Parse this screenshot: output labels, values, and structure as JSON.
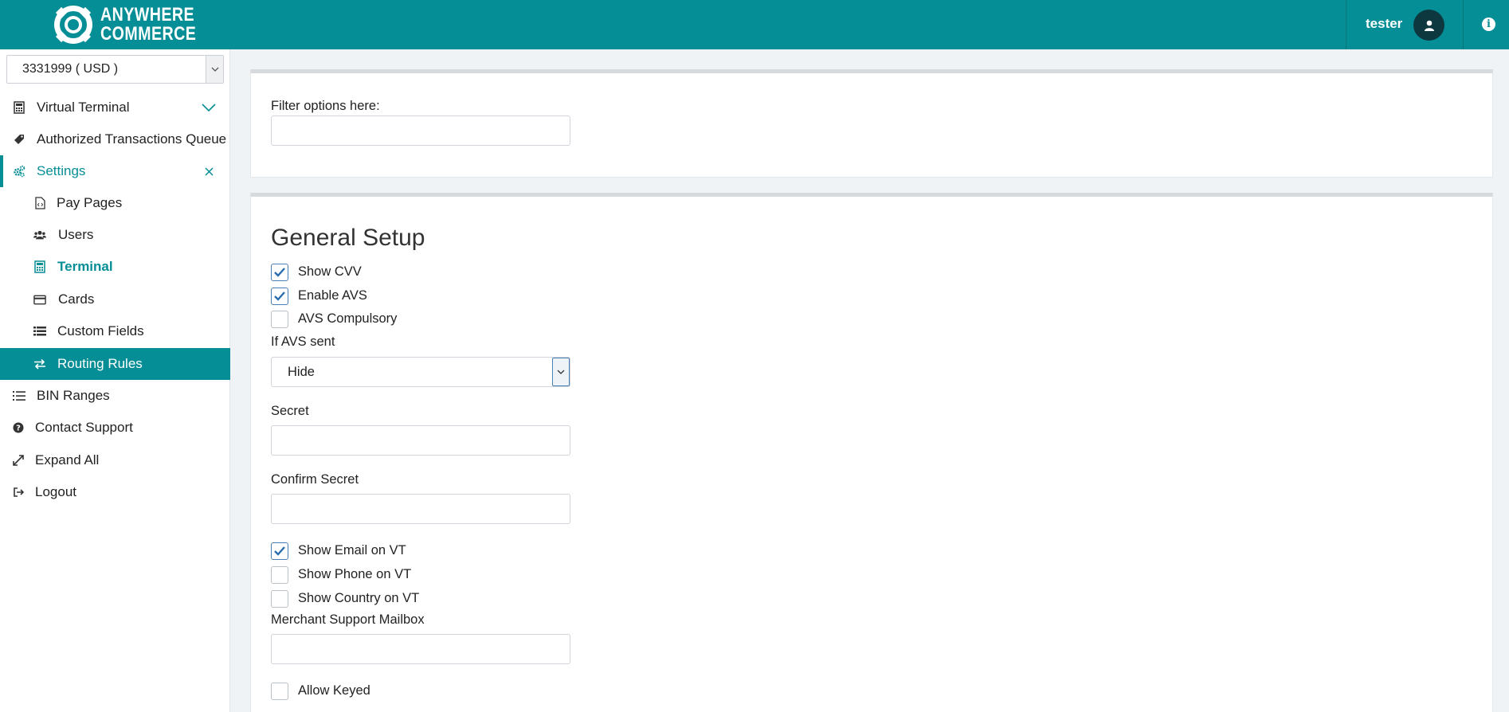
{
  "header": {
    "logo_line1": "ANYWHERE",
    "logo_line2": "COMMERCE",
    "user_name": "tester",
    "avatar_icon": "user-icon",
    "info_icon": "info-icon",
    "brand_color": "#068e96"
  },
  "sidebar": {
    "account_select": {
      "value": "3331999 ( USD )"
    },
    "items": [
      {
        "label": "Virtual Terminal",
        "icon": "calculator-icon",
        "trailing": "chevron-down-icon"
      },
      {
        "label": "Authorized Transactions Queue",
        "icon": "tag-icon"
      },
      {
        "label": "Settings",
        "icon": "cogs-icon",
        "trailing": "close-icon"
      },
      {
        "label": "Pay Pages",
        "icon": "file-code-icon"
      },
      {
        "label": "Users",
        "icon": "users-icon"
      },
      {
        "label": "Terminal",
        "icon": "calculator-icon"
      },
      {
        "label": "Cards",
        "icon": "credit-card-icon"
      },
      {
        "label": "Custom Fields",
        "icon": "list-icon"
      },
      {
        "label": "Routing Rules",
        "icon": "exchange-icon"
      },
      {
        "label": "BIN Ranges",
        "icon": "list-ol-icon"
      },
      {
        "label": "Contact Support",
        "icon": "question-circle-icon"
      },
      {
        "label": "Expand All",
        "icon": "expand-icon"
      },
      {
        "label": "Logout",
        "icon": "sign-out-icon"
      }
    ]
  },
  "filter": {
    "label": "Filter options here:",
    "value": "",
    "placeholder": ""
  },
  "general_setup": {
    "title": "General Setup",
    "show_cvv": {
      "label": "Show CVV",
      "checked": true
    },
    "enable_avs": {
      "label": "Enable AVS",
      "checked": true
    },
    "avs_compulsory": {
      "label": "AVS Compulsory",
      "checked": false
    },
    "if_avs_sent": {
      "label": "If AVS sent",
      "value": "Hide"
    },
    "secret": {
      "label": "Secret",
      "value": ""
    },
    "confirm_secret": {
      "label": "Confirm Secret",
      "value": ""
    },
    "show_email": {
      "label": "Show Email on VT",
      "checked": true
    },
    "show_phone": {
      "label": "Show Phone on VT",
      "checked": false
    },
    "show_country": {
      "label": "Show Country on VT",
      "checked": false
    },
    "merchant_mailbox": {
      "label": "Merchant Support Mailbox",
      "value": ""
    },
    "allow_keyed": {
      "label": "Allow Keyed",
      "checked": false
    }
  }
}
